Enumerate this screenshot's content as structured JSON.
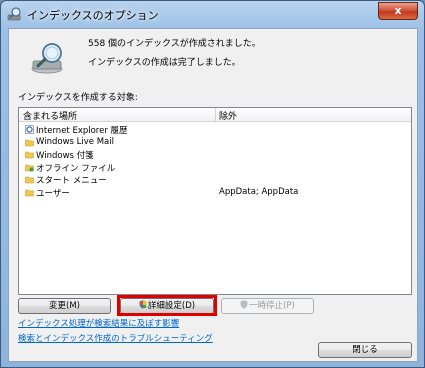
{
  "window": {
    "title": "インデックスのオプション",
    "close_label": "x"
  },
  "status": {
    "line1": "558 個のインデックスが作成されました。",
    "line2": "インデックスの作成は完了しました。"
  },
  "section_label": "インデックスを作成する対象:",
  "list": {
    "columns": [
      "含まれる場所",
      "除外"
    ],
    "rows": [
      {
        "icon": "ie-icon",
        "name": "Internet Explorer 履歴",
        "exclude": ""
      },
      {
        "icon": "folder-icon",
        "name": "Windows Live Mail",
        "exclude": ""
      },
      {
        "icon": "folder-icon",
        "name": "Windows 付箋",
        "exclude": ""
      },
      {
        "icon": "offline-files-icon",
        "name": "オフライン ファイル",
        "exclude": ""
      },
      {
        "icon": "folder-icon",
        "name": "スタート メニュー",
        "exclude": ""
      },
      {
        "icon": "folder-icon",
        "name": "ユーザー",
        "exclude": "AppData; AppData"
      }
    ]
  },
  "buttons": {
    "change": "変更(M)",
    "advanced": "詳細設定(D)",
    "pause": "一時停止(P)",
    "close": "閉じる"
  },
  "links": {
    "link1": "インデックス処理が検索結果に及ぼす影響",
    "link2": "検索とインデックス作成のトラブルシューティング"
  },
  "colors": {
    "highlight": "#e00000",
    "link": "#0066cc"
  }
}
